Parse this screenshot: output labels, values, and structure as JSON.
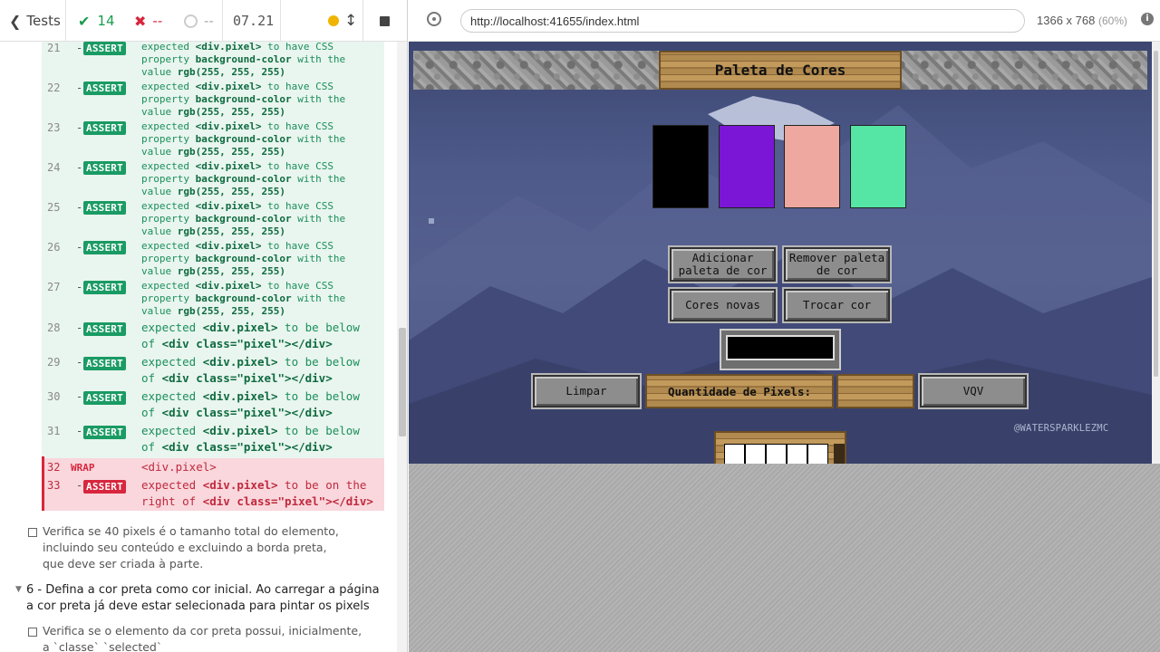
{
  "runner": {
    "tests_label": "Tests",
    "passed": "14",
    "failed": "--",
    "pending": "--",
    "duration": "07.21"
  },
  "commands": [
    {
      "num": "21",
      "dash": "-",
      "badge": "ASSERT",
      "pre": "expected ",
      "el": "<div.pixel>",
      "mid": " to have CSS property ",
      "prop": "background-color",
      "with": " with the value ",
      "val": "rgb(255, 255, 255)"
    },
    {
      "num": "22",
      "dash": "-",
      "badge": "ASSERT",
      "pre": "expected ",
      "el": "<div.pixel>",
      "mid": " to have CSS property ",
      "prop": "background-color",
      "with": " with the value ",
      "val": "rgb(255, 255, 255)"
    },
    {
      "num": "23",
      "dash": "-",
      "badge": "ASSERT",
      "pre": "expected ",
      "el": "<div.pixel>",
      "mid": " to have CSS property ",
      "prop": "background-color",
      "with": " with the value ",
      "val": "rgb(255, 255, 255)"
    },
    {
      "num": "24",
      "dash": "-",
      "badge": "ASSERT",
      "pre": "expected ",
      "el": "<div.pixel>",
      "mid": " to have CSS property ",
      "prop": "background-color",
      "with": " with the value ",
      "val": "rgb(255, 255, 255)"
    },
    {
      "num": "25",
      "dash": "-",
      "badge": "ASSERT",
      "pre": "expected ",
      "el": "<div.pixel>",
      "mid": " to have CSS property ",
      "prop": "background-color",
      "with": " with the value ",
      "val": "rgb(255, 255, 255)"
    },
    {
      "num": "26",
      "dash": "-",
      "badge": "ASSERT",
      "pre": "expected ",
      "el": "<div.pixel>",
      "mid": " to have CSS property ",
      "prop": "background-color",
      "with": " with the value ",
      "val": "rgb(255, 255, 255)"
    },
    {
      "num": "27",
      "dash": "-",
      "badge": "ASSERT",
      "pre": "expected ",
      "el": "<div.pixel>",
      "mid": " to have CSS property ",
      "prop": "background-color",
      "with": " with the value ",
      "val": "rgb(255, 255, 255)"
    }
  ],
  "below_commands": [
    {
      "num": "28",
      "dash": "-",
      "badge": "ASSERT",
      "pre": "expected ",
      "el": "<div.pixel>",
      "mid": " to be below of ",
      "target": "<div class=\"pixel\"></div>"
    },
    {
      "num": "29",
      "dash": "-",
      "badge": "ASSERT",
      "pre": "expected ",
      "el": "<div.pixel>",
      "mid": " to be below of ",
      "target": "<div class=\"pixel\"></div>"
    },
    {
      "num": "30",
      "dash": "-",
      "badge": "ASSERT",
      "pre": "expected ",
      "el": "<div.pixel>",
      "mid": " to be below of ",
      "target": "<div class=\"pixel\"></div>"
    },
    {
      "num": "31",
      "dash": "-",
      "badge": "ASSERT",
      "pre": "expected ",
      "el": "<div.pixel>",
      "mid": " to be below of ",
      "target": "<div class=\"pixel\"></div>"
    }
  ],
  "wrap_command": {
    "num": "32",
    "keyword": "WRAP",
    "msg": "<div.pixel>"
  },
  "error_command": {
    "num": "33",
    "dash": "-",
    "badge": "ASSERT",
    "pre": "expected ",
    "el": "<div.pixel>",
    "mid1": " to be on the",
    "mid2": "right of ",
    "target": "<div class=\"pixel\"></div>"
  },
  "test_desc_1": "Verifica se 40 pixels é o tamanho total do elemento, incluindo seu conteúdo e excluindo a borda preta, que deve ser criada à parte.",
  "suite_6": "6 - Defina a cor preta como cor inicial. Ao carregar a página a cor preta já deve estar selecionada para pintar os pixels",
  "test_desc_2": "Verifica se o elemento da cor preta possui, inicialmente, a `classe` `selected`",
  "browser": {
    "url": "http://localhost:41655/index.html",
    "viewport": "1366 x 768",
    "scale": "(60%)"
  },
  "app": {
    "title": "Paleta de Cores",
    "palette_colors": [
      "#000000",
      "#7b16d6",
      "#eea8a0",
      "#55e6a6"
    ],
    "buttons": {
      "add_palette": "Adicionar paleta de cor",
      "remove_palette": "Remover paleta de cor",
      "new_colors": "Cores novas",
      "swap_color": "Trocar cor",
      "clear": "Limpar",
      "vqv": "VQV"
    },
    "pixel_qty_label": "Quantidade de Pixels:",
    "watermark": "@WATERSPARKLEZMC"
  },
  "colors": {
    "pass_green": "#1b9c4f",
    "fail_red": "#d7263d",
    "badge_green": "#1a9b64"
  }
}
